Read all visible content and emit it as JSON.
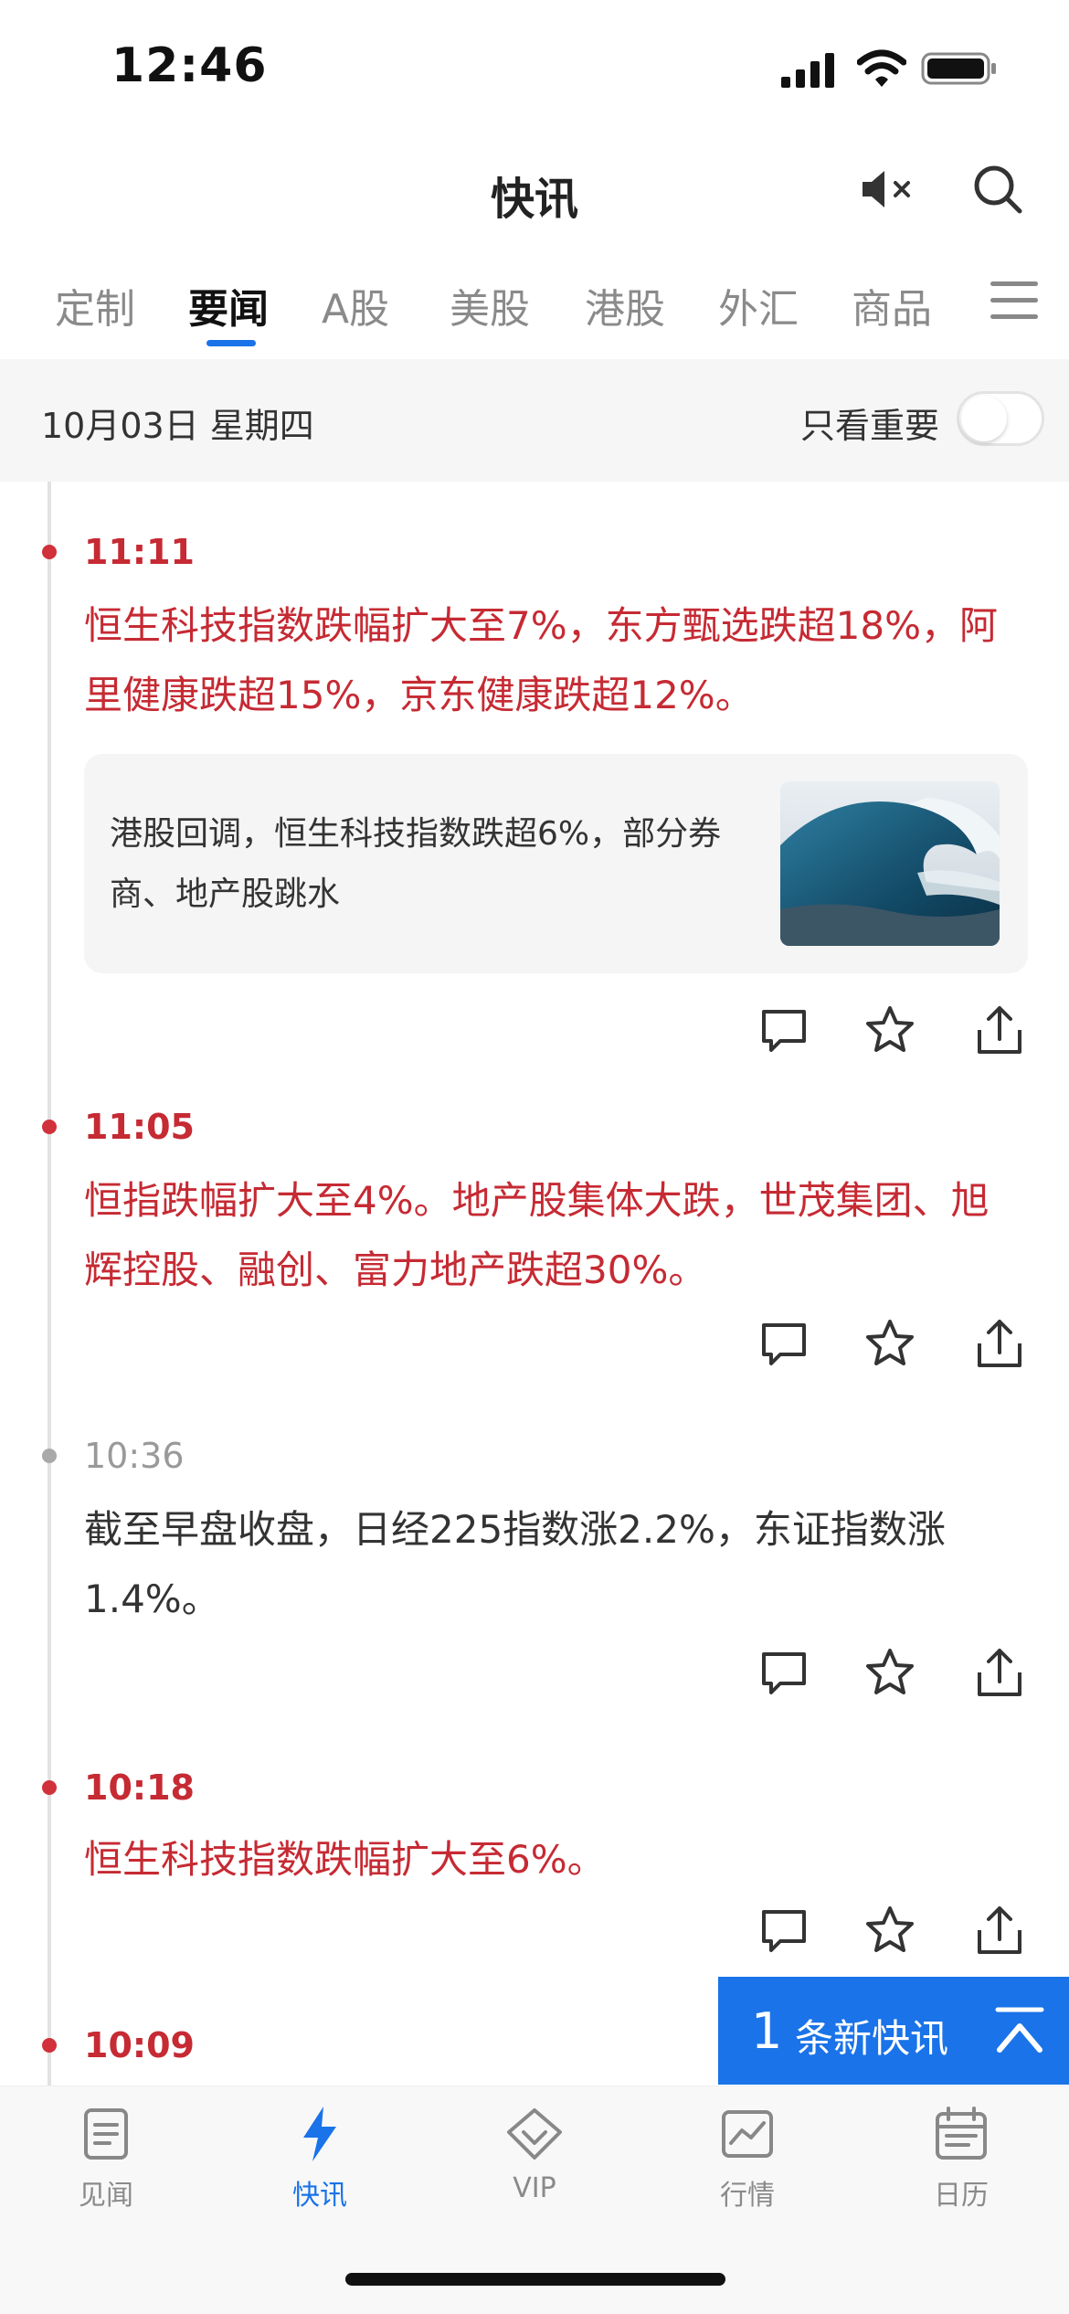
{
  "status_bar": {
    "time": "12:46"
  },
  "header": {
    "title": "快讯"
  },
  "tabs": [
    {
      "label": "定制"
    },
    {
      "label": "要闻"
    },
    {
      "label": "A股"
    },
    {
      "label": "美股"
    },
    {
      "label": "港股"
    },
    {
      "label": "外汇"
    },
    {
      "label": "商品"
    }
  ],
  "active_tab": "要闻",
  "date_bar": {
    "date": "10月03日 星期四",
    "important_only_label": "只看重要",
    "important_only_enabled": false
  },
  "feed": [
    {
      "time": "11:11",
      "importance": "important",
      "text": "恒生科技指数跌幅扩大至7%，东方甄选跌超18%，阿里健康跌超15%，京东健康跌超12%。",
      "related_article": {
        "title": "港股回调，恒生科技指数跌超6%，部分券商、地产股跳水",
        "thumbnail": "ocean-wave-image"
      }
    },
    {
      "time": "11:05",
      "importance": "important",
      "text": "恒指跌幅扩大至4%。地产股集体大跌，世茂集团、旭辉控股、融创、富力地产跌超30%。"
    },
    {
      "time": "10:36",
      "importance": "normal",
      "text": "截至早盘收盘，日经225指数涨2.2%，东证指数涨1.4%。"
    },
    {
      "time": "10:18",
      "importance": "important",
      "text": "恒生科技指数跌幅扩大至6%。"
    },
    {
      "time": "10:09",
      "importance": "important",
      "text": ""
    }
  ],
  "new_items_banner": {
    "count": "1",
    "label": "条新快讯"
  },
  "bottom_nav": [
    {
      "label": "见闻",
      "icon": "document-icon"
    },
    {
      "label": "快讯",
      "icon": "lightning-icon"
    },
    {
      "label": "VIP",
      "icon": "diamond-icon"
    },
    {
      "label": "行情",
      "icon": "chart-icon"
    },
    {
      "label": "日历",
      "icon": "calendar-icon"
    }
  ],
  "active_nav": "快讯",
  "colors": {
    "accent": "#1a73e8",
    "important_red": "#c62a33",
    "muted_gray": "#8a8a8a"
  }
}
